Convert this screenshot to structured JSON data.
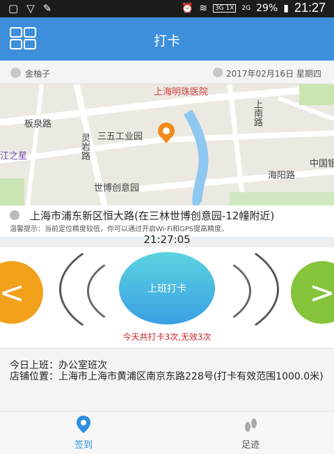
{
  "status_bar": {
    "network": "3G 1X",
    "signal_2g": "2G",
    "battery": "29%",
    "time": "21:27"
  },
  "header": {
    "title": "打卡"
  },
  "user": {
    "name": "金柚子",
    "date": "2017年02月16日 星期四"
  },
  "map": {
    "labels": [
      "上海明珠医院",
      "板泉路",
      "三五工业园",
      "灵岩路",
      "上南路",
      "世博创意园",
      "海阳路",
      "中国银",
      "江之星"
    ]
  },
  "location": {
    "address": "上海市浦东新区恒大路(在三林世博创意园-12幢附近)",
    "tip": "温馨提示：当前定位精度较低，你可以通过开启Wi-Fi和GPS提高精度。"
  },
  "clock": "21:27:05",
  "punch": {
    "button_label": "上班打卡",
    "prev_symbol": "<",
    "next_symbol": ">",
    "summary": "今天共打卡3次,无效3次"
  },
  "info": {
    "shift": "今日上班：办公室班次",
    "store": "店铺位置：上海市上海市黄浦区南京东路228号(打卡有效范围1000.0米)"
  },
  "tabs": [
    {
      "label": "签到"
    },
    {
      "label": "足迹"
    }
  ],
  "colors": {
    "brand": "#3d8fdb",
    "warning": "#cc2020"
  }
}
